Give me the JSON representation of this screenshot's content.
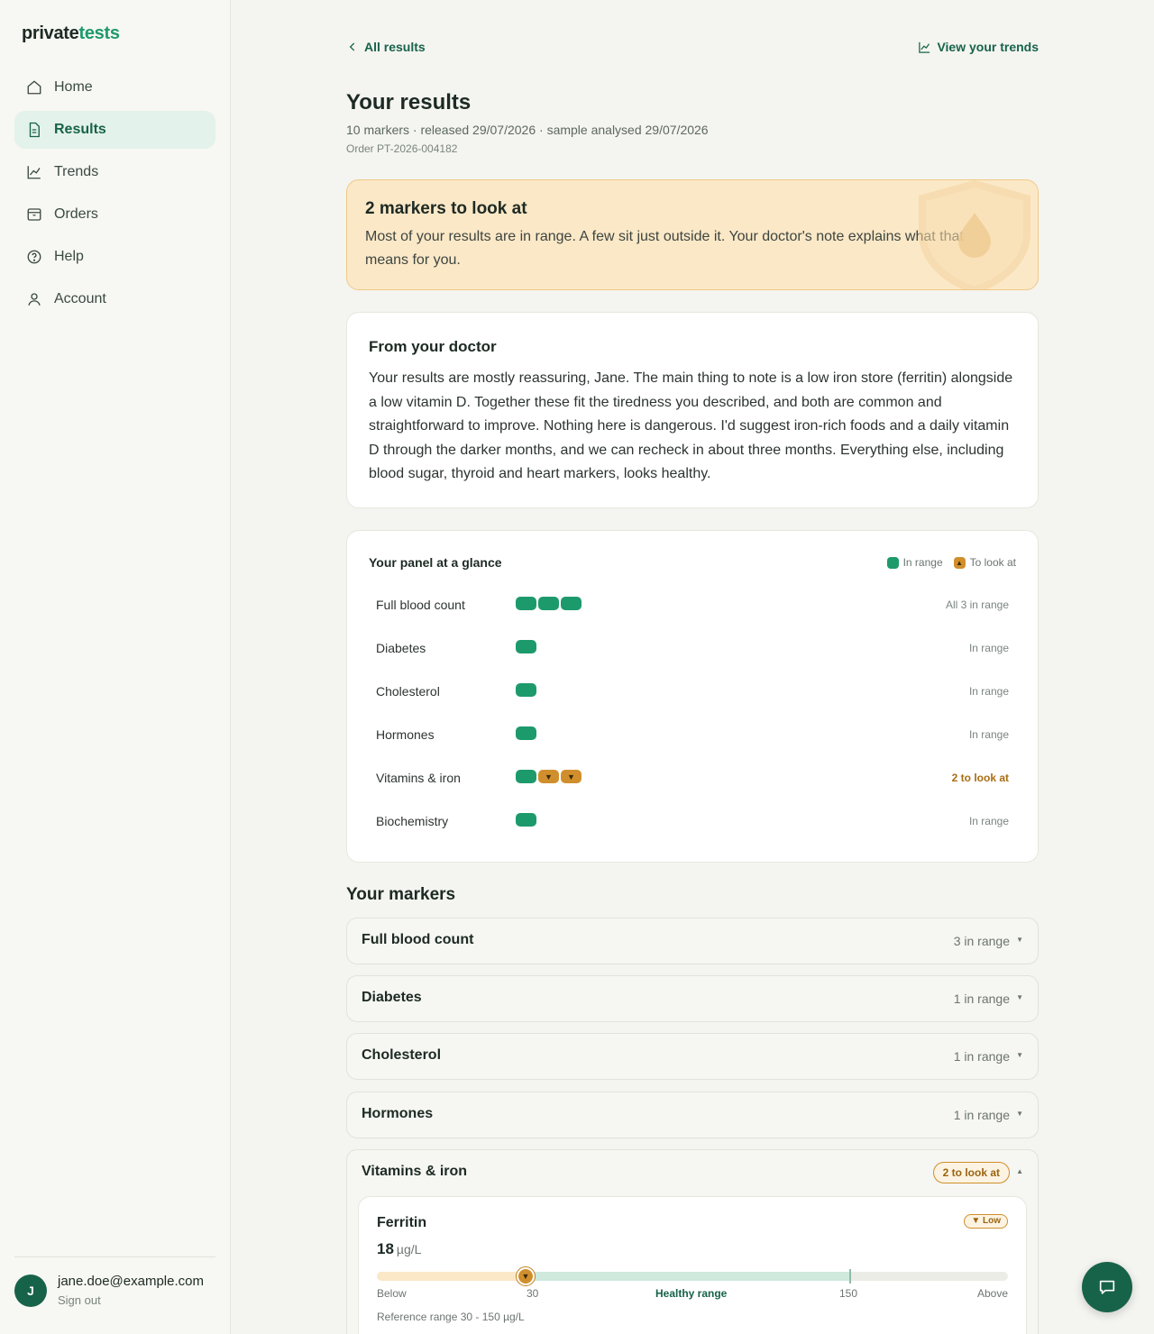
{
  "brand": {
    "part1": "private",
    "part2": "tests"
  },
  "sidebar": {
    "items": [
      {
        "label": "Home",
        "icon": "home-icon"
      },
      {
        "label": "Results",
        "icon": "document-icon",
        "active": true
      },
      {
        "label": "Trends",
        "icon": "chart-line-icon"
      },
      {
        "label": "Orders",
        "icon": "box-icon"
      },
      {
        "label": "Help",
        "icon": "help-circle-icon"
      },
      {
        "label": "Account",
        "icon": "user-icon"
      }
    ],
    "user": {
      "initial": "J",
      "email": "jane.doe@example.com",
      "sign_out": "Sign out"
    }
  },
  "topbar": {
    "back_label": "All results",
    "trends_label": "View your trends"
  },
  "header": {
    "title": "Your results",
    "meta": "10 markers · released 29/07/2026 · sample analysed 29/07/2026",
    "order": "Order PT-2026-004182"
  },
  "alert": {
    "title": "2 markers to look at",
    "body": "Most of your results are in range. A few sit just outside it. Your doctor's note explains what that means for you."
  },
  "doctor": {
    "title": "From your doctor",
    "body": "Your results are mostly reassuring, Jane. The main thing to note is a low iron store (ferritin) alongside a low vitamin D. Together these fit the tiredness you described, and both are common and straightforward to improve. Nothing here is dangerous. I'd suggest iron-rich foods and a daily vitamin D through the darker months, and we can recheck in about three months. Everything else, including blood sugar, thyroid and heart markers, looks healthy."
  },
  "glance": {
    "title": "Your panel at a glance",
    "legend_in_range": "In range",
    "legend_look_at": "To look at",
    "rows": [
      {
        "label": "Full blood count",
        "status": "All 3 in range"
      },
      {
        "label": "Diabetes",
        "status": "In range"
      },
      {
        "label": "Cholesterol",
        "status": "In range"
      },
      {
        "label": "Hormones",
        "status": "In range"
      },
      {
        "label": "Vitamins & iron",
        "status": "2 to look at"
      },
      {
        "label": "Biochemistry",
        "status": "In range"
      }
    ]
  },
  "markers": {
    "title": "Your markers",
    "groups": [
      {
        "title": "Full blood count",
        "status": "3 in range"
      },
      {
        "title": "Diabetes",
        "status": "1 in range"
      },
      {
        "title": "Cholesterol",
        "status": "1 in range"
      },
      {
        "title": "Hormones",
        "status": "1 in range"
      },
      {
        "title": "Vitamins & iron",
        "status": "2 to look at"
      }
    ],
    "ferritin": {
      "name": "Ferritin",
      "value": "18",
      "unit": "µg/L",
      "badge": "▼ Low",
      "scale_below": "Below",
      "scale_low": "30",
      "scale_healthy": "Healthy range",
      "scale_high": "150",
      "scale_above": "Above",
      "reference": "Reference range 30 - 150 µg/L"
    }
  },
  "colors": {
    "accent": "#17634a",
    "in_range": "#1d9a6c",
    "look_at": "#d08f2c",
    "alert_bg": "#fbe8c7"
  }
}
